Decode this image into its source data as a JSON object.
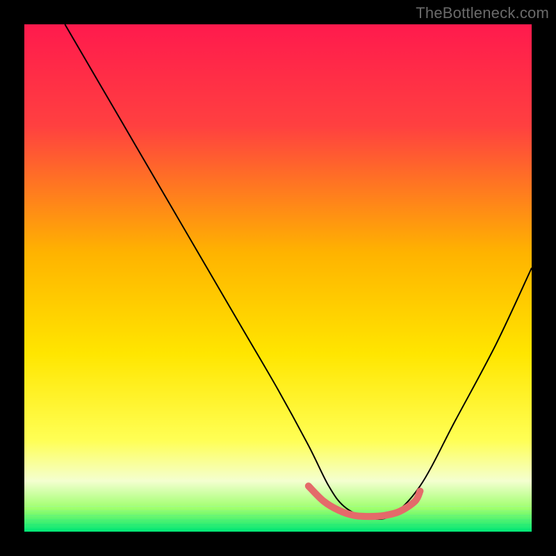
{
  "watermark": "TheBottleneck.com",
  "chart_data": {
    "type": "line",
    "title": "",
    "xlabel": "",
    "ylabel": "",
    "xlim": [
      0,
      100
    ],
    "ylim": [
      0,
      100
    ],
    "gradient_stops": [
      {
        "offset": 0.0,
        "color": "#ff1a4d"
      },
      {
        "offset": 0.2,
        "color": "#ff4040"
      },
      {
        "offset": 0.45,
        "color": "#ffb300"
      },
      {
        "offset": 0.65,
        "color": "#ffe600"
      },
      {
        "offset": 0.82,
        "color": "#ffff55"
      },
      {
        "offset": 0.9,
        "color": "#f4ffd0"
      },
      {
        "offset": 0.955,
        "color": "#9dff6b"
      },
      {
        "offset": 1.0,
        "color": "#00e676"
      }
    ],
    "series": [
      {
        "name": "bottleneck-curve",
        "color": "#000000",
        "stroke_width": 2,
        "x": [
          8,
          15,
          22,
          29,
          36,
          43,
          50,
          56,
          60,
          63,
          67,
          72,
          78,
          85,
          93,
          100
        ],
        "values": [
          100,
          88,
          76,
          64,
          52,
          40,
          28,
          17,
          9,
          5,
          3,
          3,
          9,
          22,
          37,
          52
        ]
      },
      {
        "name": "optimal-band",
        "color": "#e46a6a",
        "stroke_width": 10,
        "x": [
          56,
          59,
          62,
          65,
          68,
          71,
          74,
          77,
          78
        ],
        "values": [
          9,
          6,
          4.2,
          3.2,
          3,
          3.2,
          4,
          6,
          8
        ]
      }
    ],
    "green_base_lines": {
      "count": 6,
      "y_start": 0.5,
      "y_step": 0.9,
      "colors": [
        "#00e676",
        "#1fe97a",
        "#3fec80",
        "#5ff088",
        "#7ff491",
        "#9ff89b"
      ]
    }
  }
}
